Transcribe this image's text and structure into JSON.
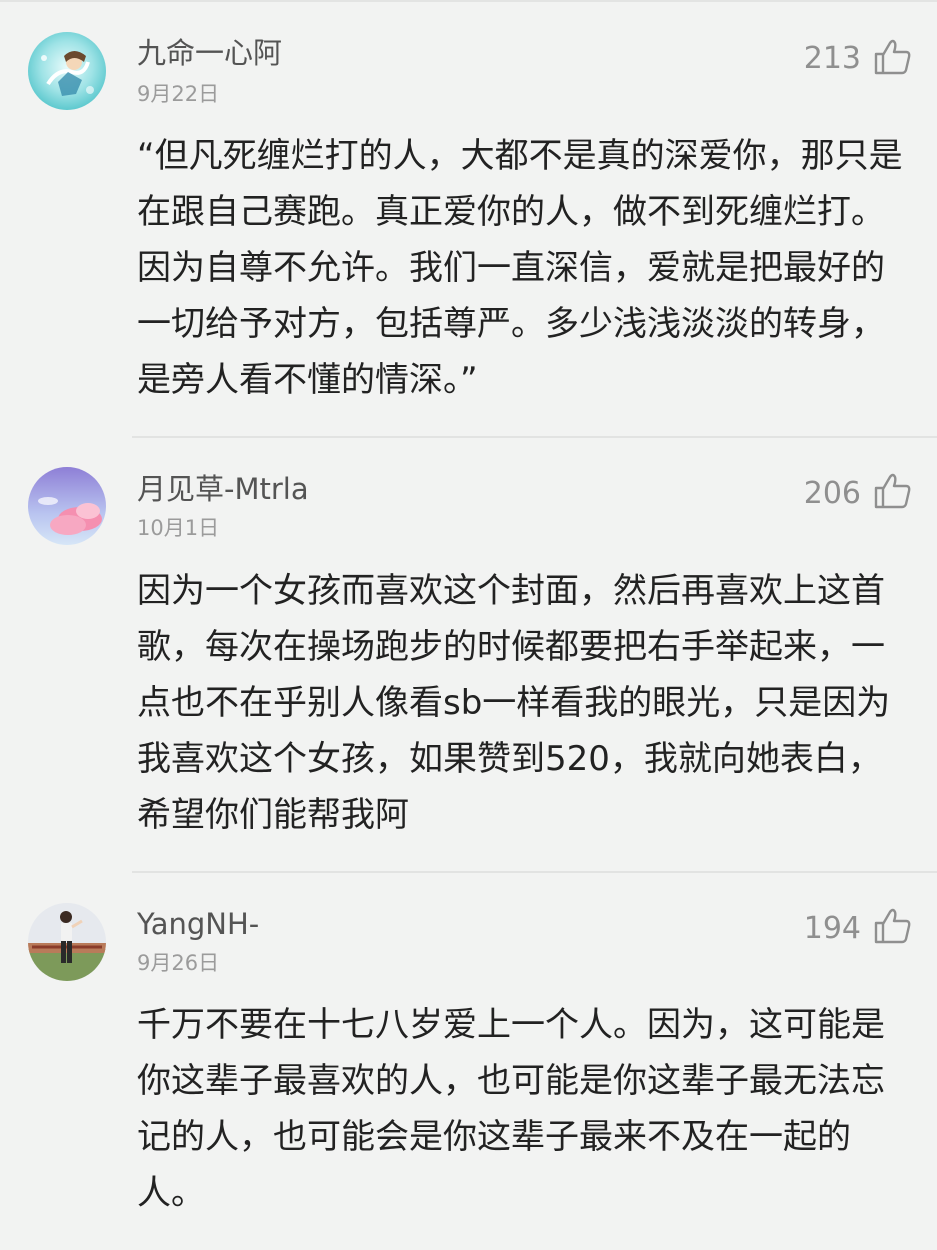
{
  "comments": [
    {
      "username": "九命一心阿",
      "date": "9月22日",
      "likes": "213",
      "avatar": "anime-avatar",
      "text": "“但凡死缠烂打的人，大都不是真的深爱你，那只是在跟自己赛跑。真正爱你的人，做不到死缠烂打。因为自尊不允许。我们一直深信，爱就是把最好的一切给予对方，包括尊严。多少浅浅淡淡的转身，是旁人看不懂的情深。”"
    },
    {
      "username": "月见草-Mtrla",
      "date": "10月1日",
      "likes": "206",
      "avatar": "pink-cloud-avatar",
      "text": "因为一个女孩而喜欢这个封面，然后再喜欢上这首歌，每次在操场跑步的时候都要把右手举起来，一点也不在乎别人像看sb一样看我的眼光，只是因为我喜欢这个女孩，如果赞到520，我就向她表白，希望你们能帮我阿"
    },
    {
      "username": "YangNH-",
      "date": "9月26日",
      "likes": "194",
      "avatar": "photo-avatar",
      "text": "千万不要在十七八岁爱上一个人。因为，这可能是你这辈子最喜欢的人，也可能是你这辈子最无法忘记的人，也可能会是你这辈子最来不及在一起的人。"
    }
  ],
  "colors": {
    "background": "#f2f3f2",
    "username": "#545454",
    "date": "#9b9b9b",
    "likes": "#8f8f8f",
    "text": "#222222"
  },
  "icons": {
    "like": "thumbs-up-icon"
  }
}
